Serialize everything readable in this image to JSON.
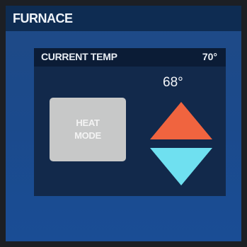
{
  "header": {
    "title": "FURNACE"
  },
  "panel": {
    "current_temp_label": "CURRENT TEMP",
    "current_temp_value": "70°",
    "setpoint": "68°",
    "mode_button": {
      "line1": "HEAT",
      "line2": "MODE"
    },
    "controls": {
      "increase_icon": "triangle-up-icon",
      "decrease_icon": "triangle-down-icon"
    }
  },
  "colors": {
    "background": "#1b4a8c",
    "title_bar": "#0e2c52",
    "panel": "#12294b",
    "mode_button": "#c7c8c8",
    "up_arrow": "#f0643f",
    "down_arrow": "#6fe0f0"
  }
}
